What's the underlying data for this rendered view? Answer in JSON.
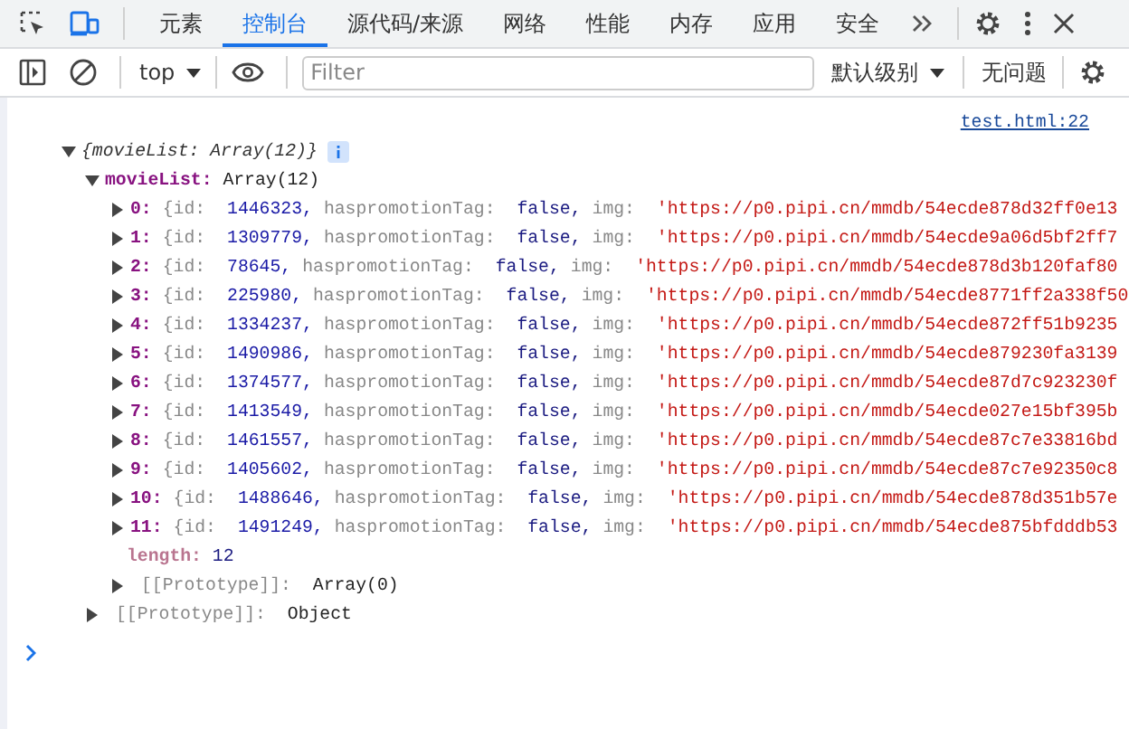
{
  "tabs": [
    {
      "label": "元素",
      "selected": false
    },
    {
      "label": "控制台",
      "selected": true
    },
    {
      "label": "源代码/来源",
      "selected": false
    },
    {
      "label": "网络",
      "selected": false
    },
    {
      "label": "性能",
      "selected": false
    },
    {
      "label": "内存",
      "selected": false
    },
    {
      "label": "应用",
      "selected": false
    },
    {
      "label": "安全",
      "selected": false
    }
  ],
  "toolbar": {
    "context": "top",
    "filter": {
      "placeholder": "Filter"
    },
    "level": "默认级别",
    "issues": "无问题"
  },
  "console": {
    "source_link": "test.html:22",
    "root": {
      "label": "{movieList: Array(12)}",
      "expanded": true,
      "child": {
        "key": "movieList:",
        "value": "Array(12)",
        "expanded": true,
        "items": [
          {
            "key": "0:",
            "expanded": false,
            "preview": [
              {
                "name": "{id:",
                "value": "1446323,",
                "kind": "number"
              },
              {
                "name": "haspromotionTag:",
                "value": "false,",
                "kind": "boolean"
              },
              {
                "name": "img:",
                "value": "'https://p0.pipi.cn/mmdb/54ecde878d32ff0e13",
                "kind": "string"
              }
            ]
          },
          {
            "key": "1:",
            "expanded": false,
            "preview": [
              {
                "name": "{id:",
                "value": "1309779,",
                "kind": "number"
              },
              {
                "name": "haspromotionTag:",
                "value": "false,",
                "kind": "boolean"
              },
              {
                "name": "img:",
                "value": "'https://p0.pipi.cn/mmdb/54ecde9a06d5bf2ff7",
                "kind": "string"
              }
            ]
          },
          {
            "key": "2:",
            "expanded": false,
            "preview": [
              {
                "name": "{id:",
                "value": "78645,",
                "kind": "number"
              },
              {
                "name": "haspromotionTag:",
                "value": "false,",
                "kind": "boolean"
              },
              {
                "name": "img:",
                "value": "'https://p0.pipi.cn/mmdb/54ecde878d3b120faf80",
                "kind": "string"
              }
            ]
          },
          {
            "key": "3:",
            "expanded": false,
            "preview": [
              {
                "name": "{id:",
                "value": "225980,",
                "kind": "number"
              },
              {
                "name": "haspromotionTag:",
                "value": "false,",
                "kind": "boolean"
              },
              {
                "name": "img:",
                "value": "'https://p0.pipi.cn/mmdb/54ecde8771ff2a338f50",
                "kind": "string"
              }
            ]
          },
          {
            "key": "4:",
            "expanded": false,
            "preview": [
              {
                "name": "{id:",
                "value": "1334237,",
                "kind": "number"
              },
              {
                "name": "haspromotionTag:",
                "value": "false,",
                "kind": "boolean"
              },
              {
                "name": "img:",
                "value": "'https://p0.pipi.cn/mmdb/54ecde872ff51b9235",
                "kind": "string"
              }
            ]
          },
          {
            "key": "5:",
            "expanded": false,
            "preview": [
              {
                "name": "{id:",
                "value": "1490986,",
                "kind": "number"
              },
              {
                "name": "haspromotionTag:",
                "value": "false,",
                "kind": "boolean"
              },
              {
                "name": "img:",
                "value": "'https://p0.pipi.cn/mmdb/54ecde879230fa3139",
                "kind": "string"
              }
            ]
          },
          {
            "key": "6:",
            "expanded": false,
            "preview": [
              {
                "name": "{id:",
                "value": "1374577,",
                "kind": "number"
              },
              {
                "name": "haspromotionTag:",
                "value": "false,",
                "kind": "boolean"
              },
              {
                "name": "img:",
                "value": "'https://p0.pipi.cn/mmdb/54ecde87d7c923230f",
                "kind": "string"
              }
            ]
          },
          {
            "key": "7:",
            "expanded": false,
            "preview": [
              {
                "name": "{id:",
                "value": "1413549,",
                "kind": "number"
              },
              {
                "name": "haspromotionTag:",
                "value": "false,",
                "kind": "boolean"
              },
              {
                "name": "img:",
                "value": "'https://p0.pipi.cn/mmdb/54ecde027e15bf395b",
                "kind": "string"
              }
            ]
          },
          {
            "key": "8:",
            "expanded": false,
            "preview": [
              {
                "name": "{id:",
                "value": "1461557,",
                "kind": "number"
              },
              {
                "name": "haspromotionTag:",
                "value": "false,",
                "kind": "boolean"
              },
              {
                "name": "img:",
                "value": "'https://p0.pipi.cn/mmdb/54ecde87c7e33816bd",
                "kind": "string"
              }
            ]
          },
          {
            "key": "9:",
            "expanded": false,
            "preview": [
              {
                "name": "{id:",
                "value": "1405602,",
                "kind": "number"
              },
              {
                "name": "haspromotionTag:",
                "value": "false,",
                "kind": "boolean"
              },
              {
                "name": "img:",
                "value": "'https://p0.pipi.cn/mmdb/54ecde87c7e92350c8",
                "kind": "string"
              }
            ]
          },
          {
            "key": "10:",
            "expanded": false,
            "preview": [
              {
                "name": "{id:",
                "value": "1488646,",
                "kind": "number"
              },
              {
                "name": "haspromotionTag:",
                "value": "false,",
                "kind": "boolean"
              },
              {
                "name": "img:",
                "value": "'https://p0.pipi.cn/mmdb/54ecde878d351b57e",
                "kind": "string"
              }
            ]
          },
          {
            "key": "11:",
            "expanded": false,
            "preview": [
              {
                "name": "{id:",
                "value": "1491249,",
                "kind": "number"
              },
              {
                "name": "haspromotionTag:",
                "value": "false,",
                "kind": "boolean"
              },
              {
                "name": "img:",
                "value": "'https://p0.pipi.cn/mmdb/54ecde875bfdddb53",
                "kind": "string"
              }
            ]
          }
        ],
        "length": {
          "key": "length:",
          "value": "12"
        },
        "proto": {
          "key": "[[Prototype]]:",
          "value": "Array(0)",
          "expanded": false
        }
      },
      "proto": {
        "key": "[[Prototype]]:",
        "value": "Object",
        "expanded": false
      }
    }
  }
}
